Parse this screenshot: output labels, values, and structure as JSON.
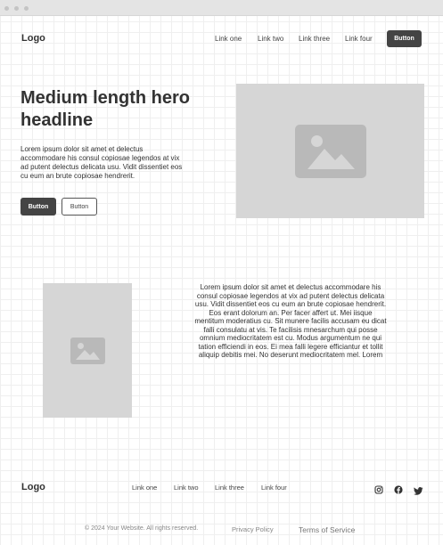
{
  "header": {
    "logo": "Logo",
    "nav": [
      "Link one",
      "Link two",
      "Link three",
      "Link four"
    ],
    "button": "Button"
  },
  "hero": {
    "title_line1": "Medium length hero",
    "title_line2": "headline",
    "body": [
      "Lorem ipsum dolor sit amet et delectus",
      "accommodare his consul copiosae legendos at vix",
      "ad putent delectus delicata usu. Vidit dissentiet eos",
      "cu eum an brute copiosae hendrerit."
    ],
    "primary_button": "Button",
    "secondary_button": "Button",
    "image_icon": "image-icon"
  },
  "feature": {
    "image_icon": "image-icon",
    "paragraph": [
      "Lorem ipsum dolor sit amet et delectus accommodare his",
      "consul copiosae legendos at vix ad putent delectus delicata",
      "usu. Vidit dissentiet eos cu eum an brute copiosae hendrerit.",
      "Eos erant dolorum an. Per facer affert ut. Mei iisque",
      "mentitum moderatius cu. Sit munere facilis accusam eu dicat",
      "falli consulatu at vis. Te facilisis mnesarchum qui posse",
      "omnium mediocritatem est cu. Modus argumentum ne qui",
      "tation efficiendi in eos. Ei mea falli legere efficiantur et tollit",
      "aliquip debitis mei. No deserunt mediocritatem mel. Lorem"
    ]
  },
  "footer": {
    "logo": "Logo",
    "nav": [
      "Link one",
      "Link two",
      "Link three",
      "Link four"
    ],
    "social_icons": [
      "instagram-icon",
      "facebook-icon",
      "twitter-icon"
    ],
    "copyright": "© 2024 Your Website. All rights reserved.",
    "privacy": "Privacy Policy",
    "terms": "Terms of Service"
  }
}
